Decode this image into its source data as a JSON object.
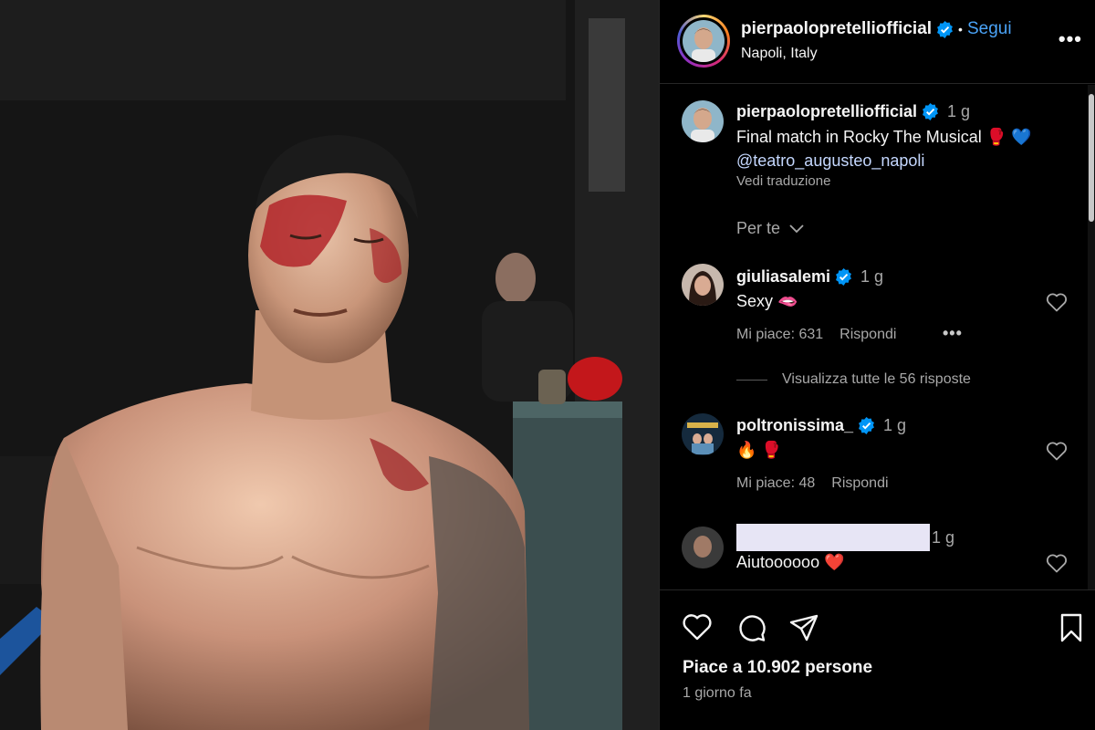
{
  "post": {
    "username": "pierpaolopretelliofficial",
    "follow_label": "Segui",
    "separator": "•",
    "location": "Napoli, Italy",
    "more": "•••"
  },
  "caption": {
    "username": "pierpaolopretelliofficial",
    "time": "1 g",
    "text": "Final match in Rocky The Musical 🥊 💙",
    "mention": "@teatro_augusteo_napoli",
    "translate_label": "Vedi traduzione",
    "filter_label": "Per te",
    "filter_icon": "chevron-down-icon"
  },
  "comments": [
    {
      "username": "giuliasalemi",
      "verified": true,
      "time": "1 g",
      "text": "Sexy 🫦",
      "likes_label": "Mi piace: 631",
      "reply_label": "Rispondi",
      "more": "•••",
      "view_replies": "Visualizza tutte le 56 risposte"
    },
    {
      "username": "poltronissima_",
      "verified": true,
      "time": "1 g",
      "text": "🔥 🥊",
      "likes_label": "Mi piace: 48",
      "reply_label": "Rispondi"
    },
    {
      "username": "",
      "verified": false,
      "time": "1 g",
      "text": "Aiutoooooo ❤️"
    }
  ],
  "footer": {
    "likes_text": "Piace a 10.902 persone",
    "date_text": "1 giorno fa"
  },
  "icons": {
    "like": "heart-icon",
    "comment": "comment-icon",
    "share": "paper-plane-icon",
    "save": "bookmark-icon",
    "verified": "verified-badge-icon",
    "options": "more-options-icon"
  },
  "colors": {
    "background": "#000000",
    "text": "#f5f5f5",
    "secondary_text": "#a8a8a8",
    "link": "#4aa3f7",
    "mention": "#c5d8ff",
    "verified": "#0095f6"
  }
}
